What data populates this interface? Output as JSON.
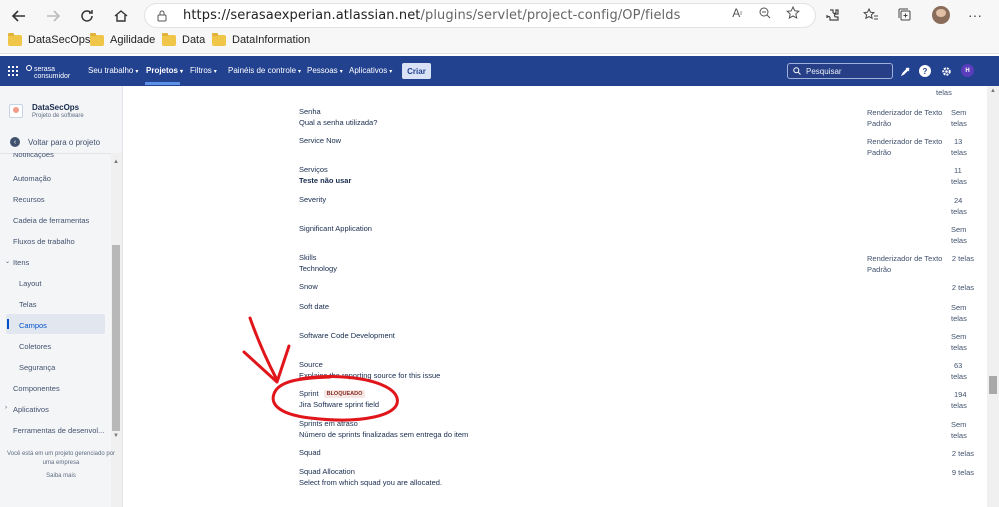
{
  "browser": {
    "url_host": "https://serasaexperian.atlassian.net",
    "url_path": "/plugins/servlet/project-config/OP/fields",
    "bookmarks": [
      {
        "label": "DataSecOps"
      },
      {
        "label": "Agilidade"
      },
      {
        "label": "Data"
      },
      {
        "label": "DataInformation"
      }
    ]
  },
  "header": {
    "logo_line1": "serasa",
    "logo_line2": "consumidor",
    "nav": [
      {
        "label": "Seu trabalho"
      },
      {
        "label": "Projetos"
      },
      {
        "label": "Filtros"
      },
      {
        "label": "Painéis de controle"
      },
      {
        "label": "Pessoas"
      },
      {
        "label": "Aplicativos"
      }
    ],
    "create_label": "Criar",
    "search_placeholder": "Pesquisar",
    "avatar_initial": "H"
  },
  "sidebar": {
    "project_name": "DataSecOps",
    "project_type": "Projeto de software",
    "back_label": "Voltar para o projeto",
    "items": [
      {
        "label": "Notificações"
      },
      {
        "label": "Automação"
      },
      {
        "label": "Recursos"
      },
      {
        "label": "Cadeia de ferramentas"
      },
      {
        "label": "Fluxos de trabalho"
      },
      {
        "label": "Itens"
      },
      {
        "label": "Layout"
      },
      {
        "label": "Telas"
      },
      {
        "label": "Campos"
      },
      {
        "label": "Coletores"
      },
      {
        "label": "Segurança"
      },
      {
        "label": "Componentes"
      },
      {
        "label": "Aplicativos"
      },
      {
        "label": "Ferramentas de desenvol..."
      }
    ],
    "footer_text_1": "Você está em um projeto gerenciado por",
    "footer_text_2": "uma empresa",
    "footer_more": "Saiba mais"
  },
  "fields": [
    {
      "name": "",
      "desc": "",
      "renderer_1": "",
      "renderer_2": "",
      "screens_1": "telas",
      "screens_2": ""
    },
    {
      "name": "Senha",
      "desc": "Qual a senha utilizada?",
      "renderer_1": "Renderizador de Texto",
      "renderer_2": "Padrão",
      "screens_1": "Sem",
      "screens_2": "telas"
    },
    {
      "name": "Service Now",
      "desc": "",
      "renderer_1": "Renderizador de Texto",
      "renderer_2": "Padrão",
      "screens_1": "13",
      "screens_2": "telas"
    },
    {
      "name": "Serviços",
      "desc": "Teste não usar",
      "renderer_1": "",
      "renderer_2": "",
      "screens_1": "11",
      "screens_2": "telas"
    },
    {
      "name": "Severity",
      "desc": "",
      "renderer_1": "",
      "renderer_2": "",
      "screens_1": "24",
      "screens_2": "telas"
    },
    {
      "name": "Significant Application",
      "desc": "",
      "renderer_1": "",
      "renderer_2": "",
      "screens_1": "Sem",
      "screens_2": "telas"
    },
    {
      "name": "Skills",
      "desc": "Technology",
      "renderer_1": "Renderizador de Texto",
      "renderer_2": "Padrão",
      "screens_1": "2 telas",
      "screens_2": ""
    },
    {
      "name": "Snow",
      "desc": "",
      "renderer_1": "",
      "renderer_2": "",
      "screens_1": "2 telas",
      "screens_2": ""
    },
    {
      "name": "Soft date",
      "desc": "",
      "renderer_1": "",
      "renderer_2": "",
      "screens_1": "Sem",
      "screens_2": "telas"
    },
    {
      "name": "Software Code Development",
      "desc": "",
      "renderer_1": "",
      "renderer_2": "",
      "screens_1": "Sem",
      "screens_2": "telas"
    },
    {
      "name": "Source",
      "desc": "Explains the reporting source for this issue",
      "renderer_1": "",
      "renderer_2": "",
      "screens_1": "63",
      "screens_2": "telas"
    },
    {
      "name": "Sprint",
      "badge": "BLOQUEADO",
      "desc": "Jira Software sprint field",
      "renderer_1": "",
      "renderer_2": "",
      "screens_1": "194",
      "screens_2": "telas"
    },
    {
      "name": "Sprints em atraso",
      "desc": "Número de sprints finalizadas sem entrega do item",
      "renderer_1": "",
      "renderer_2": "",
      "screens_1": "Sem",
      "screens_2": "telas"
    },
    {
      "name": "Squad",
      "desc": "",
      "renderer_1": "",
      "renderer_2": "",
      "screens_1": "2 telas",
      "screens_2": ""
    },
    {
      "name": "Squad Allocation",
      "desc": "Select from which squad you are allocated.",
      "renderer_1": "",
      "renderer_2": "",
      "screens_1": "9 telas",
      "screens_2": ""
    }
  ],
  "colors": {
    "header_bg": "#22418f",
    "annotation": "#e0161b",
    "badge_text": "#8a2c1f"
  }
}
